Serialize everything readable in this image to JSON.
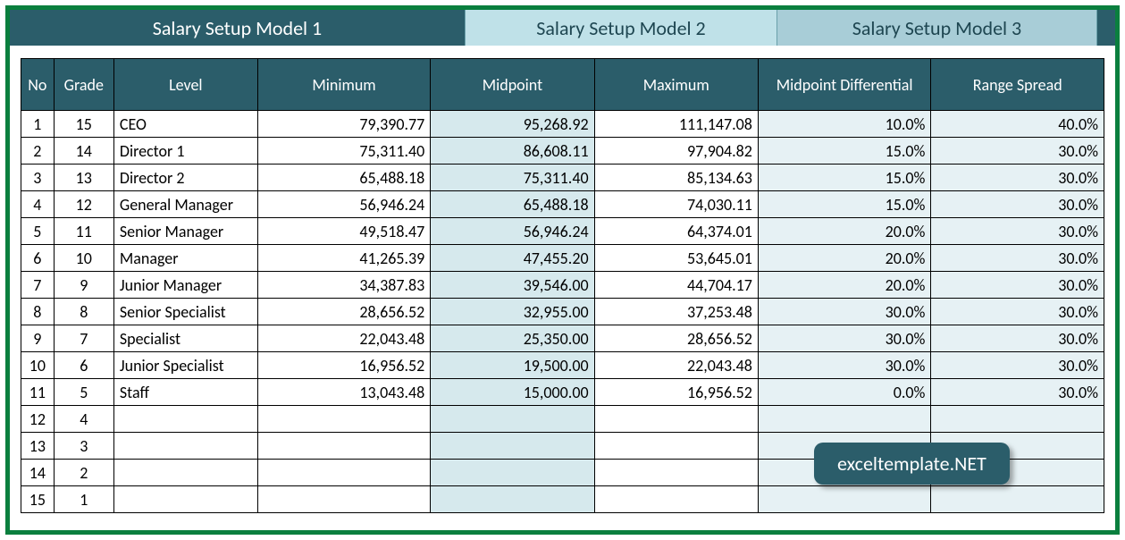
{
  "tabs": {
    "t1": "Salary Setup Model 1",
    "t2": "Salary Setup Model 2",
    "t3": "Salary Setup Model 3"
  },
  "headers": {
    "no": "No",
    "grade": "Grade",
    "level": "Level",
    "min": "Minimum",
    "mid": "Midpoint",
    "max": "Maximum",
    "diff": "Midpoint Differential",
    "spread": "Range Spread"
  },
  "rows": [
    {
      "no": "1",
      "grade": "15",
      "level": "CEO",
      "min": "79,390.77",
      "mid": "95,268.92",
      "max": "111,147.08",
      "diff": "10.0%",
      "spread": "40.0%"
    },
    {
      "no": "2",
      "grade": "14",
      "level": "Director 1",
      "min": "75,311.40",
      "mid": "86,608.11",
      "max": "97,904.82",
      "diff": "15.0%",
      "spread": "30.0%"
    },
    {
      "no": "3",
      "grade": "13",
      "level": "Director 2",
      "min": "65,488.18",
      "mid": "75,311.40",
      "max": "85,134.63",
      "diff": "15.0%",
      "spread": "30.0%"
    },
    {
      "no": "4",
      "grade": "12",
      "level": "General Manager",
      "min": "56,946.24",
      "mid": "65,488.18",
      "max": "74,030.11",
      "diff": "15.0%",
      "spread": "30.0%"
    },
    {
      "no": "5",
      "grade": "11",
      "level": "Senior Manager",
      "min": "49,518.47",
      "mid": "56,946.24",
      "max": "64,374.01",
      "diff": "20.0%",
      "spread": "30.0%"
    },
    {
      "no": "6",
      "grade": "10",
      "level": "Manager",
      "min": "41,265.39",
      "mid": "47,455.20",
      "max": "53,645.01",
      "diff": "20.0%",
      "spread": "30.0%"
    },
    {
      "no": "7",
      "grade": "9",
      "level": "Junior Manager",
      "min": "34,387.83",
      "mid": "39,546.00",
      "max": "44,704.17",
      "diff": "20.0%",
      "spread": "30.0%"
    },
    {
      "no": "8",
      "grade": "8",
      "level": "Senior Specialist",
      "min": "28,656.52",
      "mid": "32,955.00",
      "max": "37,253.48",
      "diff": "30.0%",
      "spread": "30.0%"
    },
    {
      "no": "9",
      "grade": "7",
      "level": "Specialist",
      "min": "22,043.48",
      "mid": "25,350.00",
      "max": "28,656.52",
      "diff": "30.0%",
      "spread": "30.0%"
    },
    {
      "no": "10",
      "grade": "6",
      "level": "Junior Specialist",
      "min": "16,956.52",
      "mid": "19,500.00",
      "max": "22,043.48",
      "diff": "30.0%",
      "spread": "30.0%"
    },
    {
      "no": "11",
      "grade": "5",
      "level": "Staff",
      "min": "13,043.48",
      "mid": "15,000.00",
      "max": "16,956.52",
      "diff": "0.0%",
      "spread": "30.0%"
    },
    {
      "no": "12",
      "grade": "4",
      "level": "",
      "min": "",
      "mid": "",
      "max": "",
      "diff": "",
      "spread": ""
    },
    {
      "no": "13",
      "grade": "3",
      "level": "",
      "min": "",
      "mid": "",
      "max": "",
      "diff": "",
      "spread": ""
    },
    {
      "no": "14",
      "grade": "2",
      "level": "",
      "min": "",
      "mid": "",
      "max": "",
      "diff": "",
      "spread": ""
    },
    {
      "no": "15",
      "grade": "1",
      "level": "",
      "min": "",
      "mid": "",
      "max": "",
      "diff": "",
      "spread": ""
    }
  ],
  "watermark": "exceltemplate.NET"
}
